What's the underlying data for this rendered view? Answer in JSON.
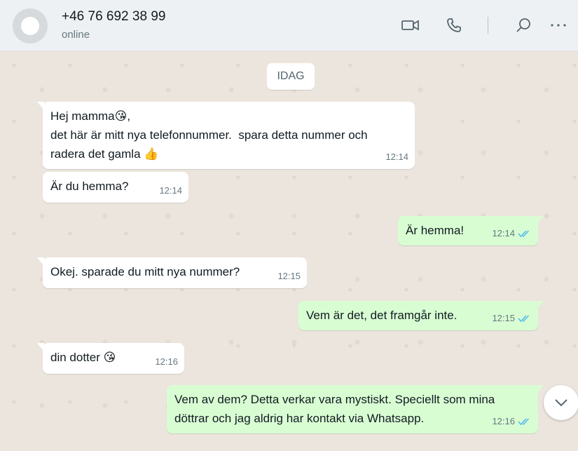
{
  "header": {
    "contact_name": "+46 76 692 38 99",
    "status": "online",
    "icons": [
      "video-call-icon",
      "voice-call-icon",
      "search-icon",
      "menu-icon"
    ]
  },
  "chat": {
    "date_label": "IDAG",
    "messages": [
      {
        "direction": "in",
        "lines": [
          "Hej mamma😘,",
          "det här är mitt nya telefonnummer.  spara detta nummer och",
          "radera det gamla 👍"
        ],
        "time": "12:14"
      },
      {
        "direction": "in",
        "text": "Är du hemma?",
        "time": "12:14"
      },
      {
        "direction": "out",
        "text": "Är hemma!",
        "time": "12:14",
        "status": "read"
      },
      {
        "direction": "in",
        "text": "Okej. sparade du mitt nya nummer?",
        "time": "12:15"
      },
      {
        "direction": "out",
        "text": "Vem är det, det framgår inte.",
        "time": "12:15",
        "status": "read"
      },
      {
        "direction": "in",
        "text": "din dotter 😘",
        "time": "12:16"
      },
      {
        "direction": "out",
        "lines": [
          "Vem av dem? Detta verkar vara mystiskt. Speciellt som mina",
          "döttrar och jag aldrig har kontakt via Whatsapp."
        ],
        "time": "12:16",
        "status": "read"
      }
    ]
  },
  "colors": {
    "incoming_bubble": "#ffffff",
    "outgoing_bubble": "#d9fdd3",
    "read_ticks": "#53bdeb",
    "header_bg": "#eef1f3",
    "chat_bg": "#ece5dd"
  }
}
